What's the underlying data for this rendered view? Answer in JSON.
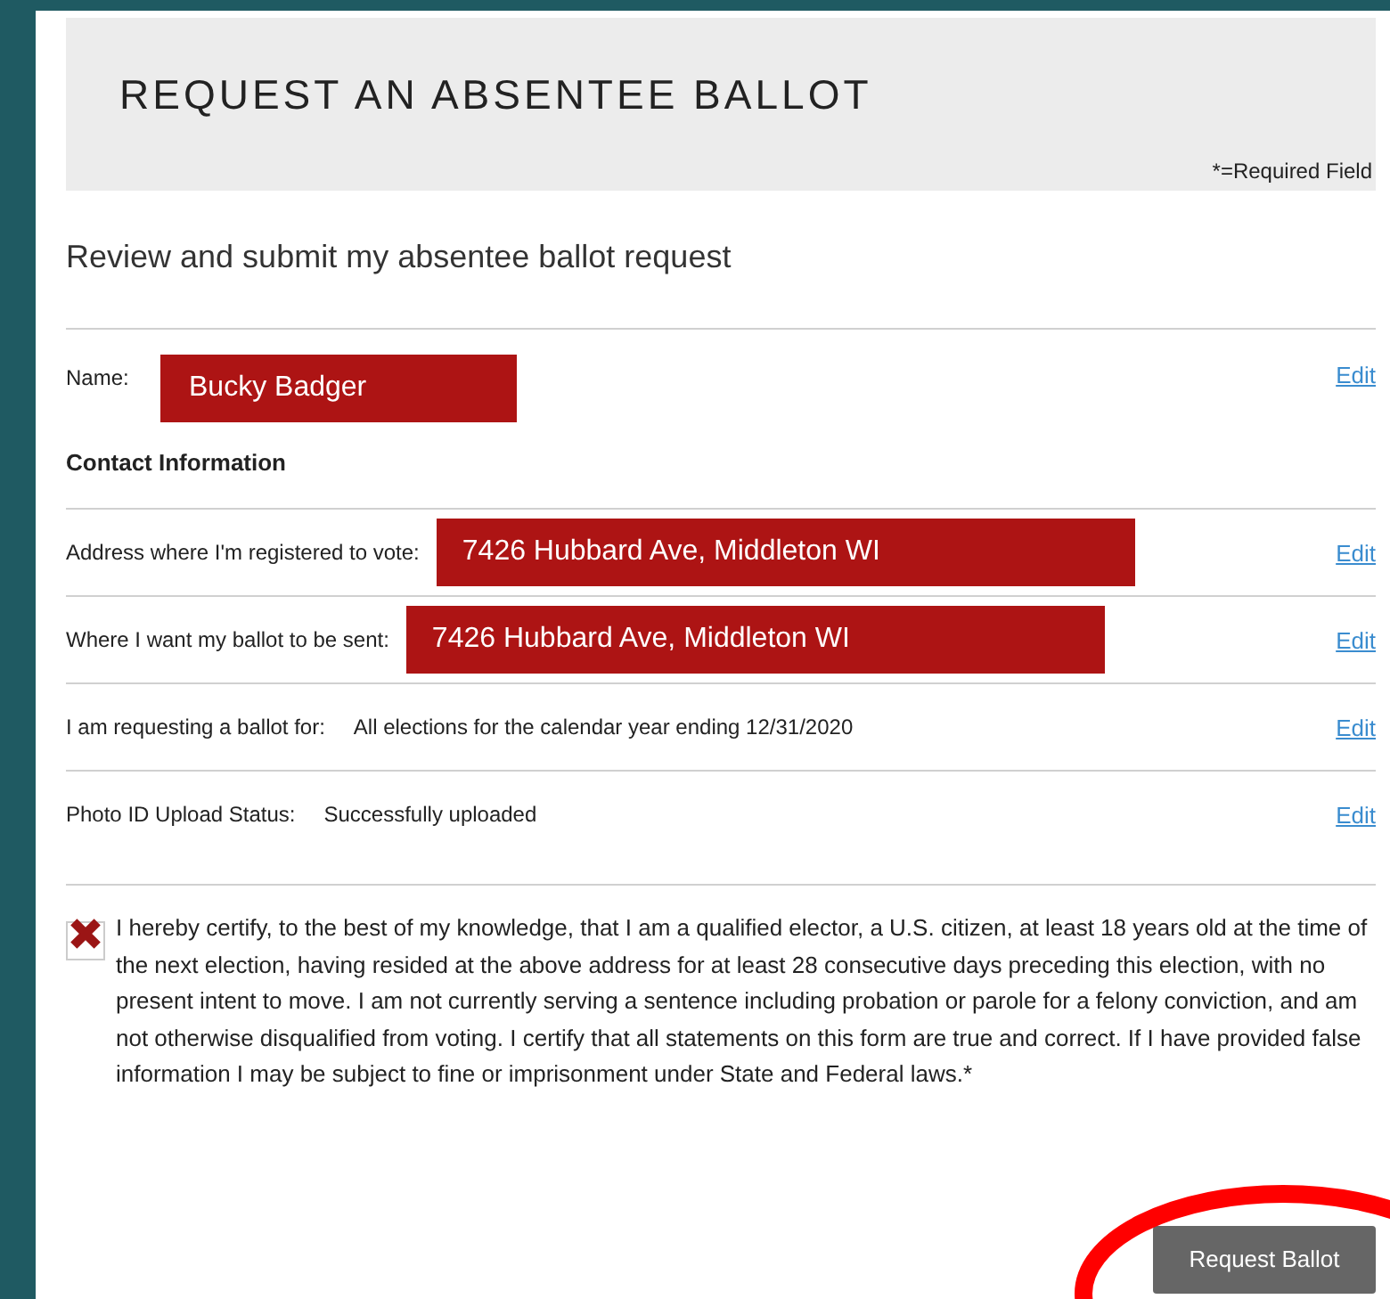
{
  "header": {
    "title": "REQUEST AN ABSENTEE BALLOT",
    "required_note": "*=Required Field"
  },
  "subtitle": "Review and submit my absentee ballot request",
  "name_row": {
    "label": "Name:",
    "value": "Bucky Badger",
    "edit": "Edit"
  },
  "section_heading": "Contact Information",
  "rows": [
    {
      "kind": "highlight",
      "label": "Address where I'm registered to vote:",
      "value": "7426 Hubbard Ave, Middleton WI",
      "edit": "Edit"
    },
    {
      "kind": "highlight",
      "label": "Where I want my ballot to be sent:",
      "value": "7426 Hubbard Ave, Middleton WI",
      "edit": "Edit"
    },
    {
      "kind": "plain",
      "label": "I am requesting a ballot for:",
      "value": "All elections for the calendar year ending 12/31/2020",
      "edit": "Edit"
    },
    {
      "kind": "plain",
      "label": "Photo ID Upload Status:",
      "value": "Successfully uploaded",
      "edit": "Edit"
    }
  ],
  "certification": {
    "checked": true,
    "text": "I hereby certify, to the best of my knowledge, that I am a qualified elector, a U.S. citizen, at least 18 years old at the time of the next election, having resided at the above address for at least 28 consecutive days preceding this election, with no present intent to move. I am not currently serving a sentence including probation or parole for a felony conviction, and am not otherwise disqualified from voting. I certify that all statements on this form are true and correct. If I have provided false information I may be subject to fine or imprisonment under State and Federal laws.*"
  },
  "submit_button": {
    "label": "Request Ballot",
    "circled": true
  }
}
